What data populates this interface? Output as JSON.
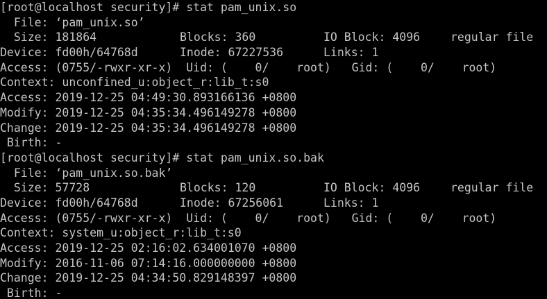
{
  "terminal": {
    "lines": [
      {
        "id": "l1",
        "segments": [
          "[root@localhost security]# stat pam_unix.so"
        ]
      },
      {
        "id": "l2",
        "segments": [
          "  File: ‘pam_unix.so’"
        ]
      },
      {
        "id": "l3",
        "segments": [
          "  Size: 181864",
          "Blocks: 360",
          "IO Block: 4096",
          "regular file"
        ]
      },
      {
        "id": "l4",
        "segments": [
          "Device: fd00h/64768d",
          "Inode: 67227536",
          "Links: 1"
        ]
      },
      {
        "id": "l5",
        "segments": [
          "Access: (0755/-rwxr-xr-x)  Uid: (    0/    root)   Gid: (    0/    root)"
        ]
      },
      {
        "id": "l6",
        "segments": [
          "Context: unconfined_u:object_r:lib_t:s0"
        ]
      },
      {
        "id": "l7",
        "segments": [
          "Access: 2019-12-25 04:49:30.893166136 +0800"
        ]
      },
      {
        "id": "l8",
        "segments": [
          "Modify: 2019-12-25 04:35:34.496149278 +0800"
        ]
      },
      {
        "id": "l9",
        "segments": [
          "Change: 2019-12-25 04:35:34.496149278 +0800"
        ]
      },
      {
        "id": "l10",
        "segments": [
          " Birth: -"
        ]
      },
      {
        "id": "l11",
        "segments": [
          "[root@localhost security]# stat pam_unix.so.bak"
        ]
      },
      {
        "id": "l12",
        "segments": [
          "  File: ‘pam_unix.so.bak’"
        ]
      },
      {
        "id": "l13",
        "segments": [
          "  Size: 57728",
          "Blocks: 120",
          "IO Block: 4096",
          "regular file"
        ]
      },
      {
        "id": "l14",
        "segments": [
          "Device: fd00h/64768d",
          "Inode: 67256061",
          "Links: 1"
        ]
      },
      {
        "id": "l15",
        "segments": [
          "Access: (0755/-rwxr-xr-x)  Uid: (    0/    root)   Gid: (    0/    root)"
        ]
      },
      {
        "id": "l16",
        "segments": [
          "Context: system_u:object_r:lib_t:s0"
        ]
      },
      {
        "id": "l17",
        "segments": [
          "Access: 2019-12-25 02:16:02.634001070 +0800"
        ]
      },
      {
        "id": "l18",
        "segments": [
          "Modify: 2016-11-06 07:14:16.000000000 +0800"
        ]
      },
      {
        "id": "l19",
        "segments": [
          "Change: 2019-12-25 04:34:50.829148397 +0800"
        ]
      },
      {
        "id": "l20",
        "segments": [
          " Birth: -"
        ]
      }
    ]
  }
}
